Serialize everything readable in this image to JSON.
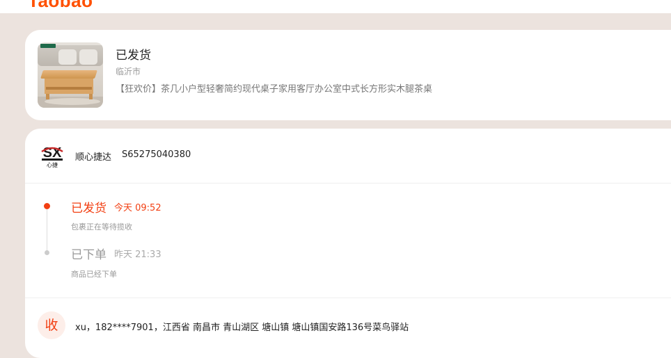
{
  "app": {
    "logo_text": "Taobao",
    "brand_color": "#ff5000",
    "accent_color": "#f23f12"
  },
  "product": {
    "status": "已发货",
    "city": "临沂市",
    "title": "【狂欢价】茶几小户型轻奢简约现代桌子家用客厅办公室中式长方形实木腿茶桌",
    "thumbnail_icon": "coffee-table-product-photo"
  },
  "shipment": {
    "courier_name": "顺心捷达",
    "tracking_number": "S65275040380",
    "courier_logo_icon": "shunxin-jieda-logo",
    "courier_logo_text": "SX",
    "courier_logo_caption": "心捷"
  },
  "timeline": [
    {
      "title": "已发货",
      "time": "今天 09:52",
      "desc": "包裹正在等待揽收",
      "state": "active"
    },
    {
      "title": "已下单",
      "time": "昨天 21:33",
      "desc": "商品已经下单",
      "state": "past"
    }
  ],
  "recipient": {
    "badge": "收",
    "address": "xu，182****7901，江西省 南昌市 青山湖区 塘山镇 塘山镇国安路136号菜鸟驿站"
  }
}
